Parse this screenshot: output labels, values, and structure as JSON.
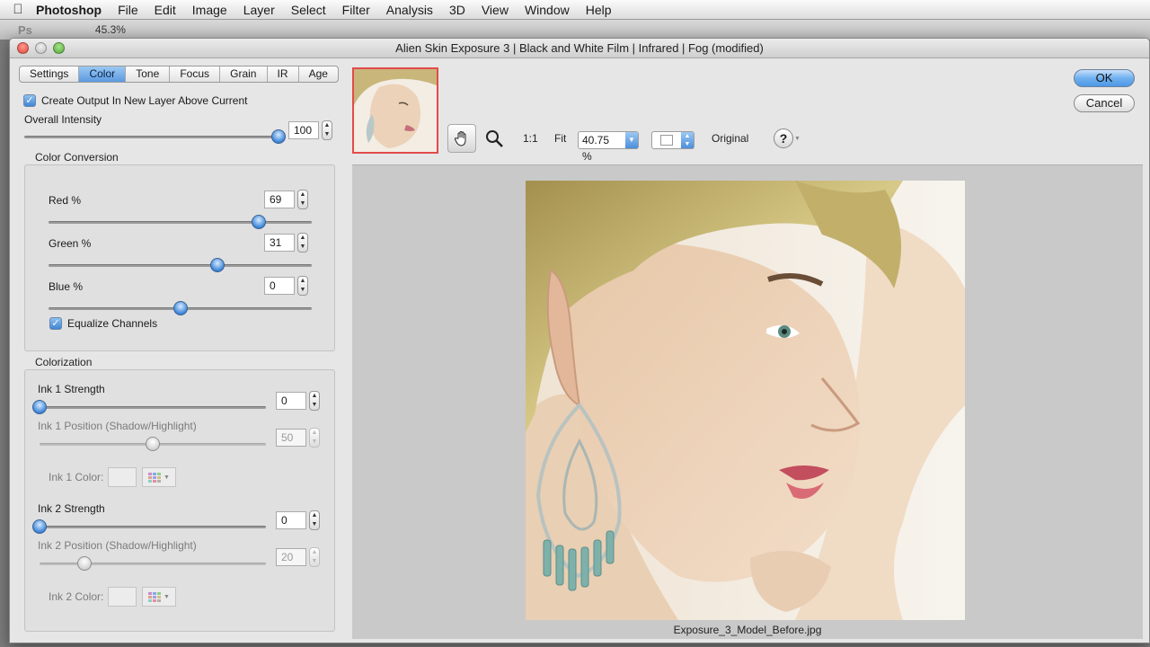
{
  "menubar": {
    "apple_glyph": "",
    "app": "Photoshop",
    "items": [
      "File",
      "Edit",
      "Image",
      "Layer",
      "Select",
      "Filter",
      "Analysis",
      "3D",
      "View",
      "Window",
      "Help"
    ]
  },
  "psbar": {
    "logo": "Ps",
    "zoom": "45.3%"
  },
  "window": {
    "title": "Alien Skin Exposure 3 | Black and White Film | Infrared | Fog (modified)"
  },
  "tabs": [
    {
      "label": "Settings",
      "active": false
    },
    {
      "label": "Color",
      "active": true
    },
    {
      "label": "Tone",
      "active": false
    },
    {
      "label": "Focus",
      "active": false
    },
    {
      "label": "Grain",
      "active": false
    },
    {
      "label": "IR",
      "active": false
    },
    {
      "label": "Age",
      "active": false
    }
  ],
  "panel": {
    "create_output_label": "Create Output In New Layer Above Current",
    "overall_intensity_label": "Overall Intensity",
    "overall_intensity_value": "100",
    "overall_intensity_fraction": 1.0,
    "color_conversion": {
      "title": "Color Conversion",
      "red_label": "Red %",
      "red_value": "69",
      "red_fraction": 0.8,
      "green_label": "Green %",
      "green_value": "31",
      "green_fraction": 0.64,
      "blue_label": "Blue %",
      "blue_value": "0",
      "blue_fraction": 0.5,
      "equalize_label": "Equalize Channels"
    },
    "colorization": {
      "title": "Colorization",
      "ink1_strength_label": "Ink 1 Strength",
      "ink1_strength_value": "0",
      "ink1_strength_fraction": 0.0,
      "ink1_position_label": "Ink 1 Position (Shadow/Highlight)",
      "ink1_position_value": "50",
      "ink1_position_fraction": 0.5,
      "ink1_color_label": "Ink 1 Color:",
      "ink2_strength_label": "Ink 2 Strength",
      "ink2_strength_value": "0",
      "ink2_strength_fraction": 0.0,
      "ink2_position_label": "Ink 2 Position (Shadow/Highlight)",
      "ink2_position_value": "20",
      "ink2_position_fraction": 0.2,
      "ink2_color_label": "Ink 2 Color:"
    }
  },
  "toolbar": {
    "one_to_one": "1:1",
    "fit": "Fit",
    "zoom_value": "40.75 %",
    "original": "Original",
    "help_glyph": "?"
  },
  "buttons": {
    "ok": "OK",
    "cancel": "Cancel"
  },
  "preview": {
    "filename": "Exposure_3_Model_Before.jpg"
  },
  "colors": {
    "accent": "#5b9ae1",
    "thumb_border": "#e24b4b"
  }
}
